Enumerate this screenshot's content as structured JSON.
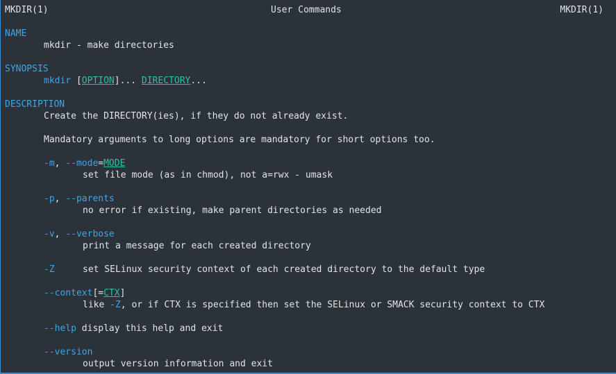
{
  "header": {
    "left": "MKDIR(1)",
    "center": "User Commands",
    "right": "MKDIR(1)"
  },
  "name": {
    "heading": "NAME",
    "text": "mkdir - make directories"
  },
  "synopsis": {
    "heading": "SYNOPSIS",
    "cmd": "mkdir",
    "lb": " [",
    "opt": "OPTION",
    "mid": "]... ",
    "dir": "DIRECTORY",
    "tail": "..."
  },
  "description": {
    "heading": "DESCRIPTION",
    "line1": "Create the DIRECTORY(ies), if they do not already exist.",
    "line2": "Mandatory arguments to long options are mandatory for short options too."
  },
  "options": {
    "mode": {
      "short": "-m",
      "sep": ", ",
      "long": "--mode",
      "eq": "=",
      "arg": "MODE",
      "desc": "set file mode (as in chmod), not a=rwx - umask"
    },
    "parents": {
      "short": "-p",
      "sep": ", ",
      "long": "--parents",
      "desc": "no error if existing, make parent directories as needed"
    },
    "verbose": {
      "short": "-v",
      "sep": ", ",
      "long": "--verbose",
      "desc": "print a message for each created directory"
    },
    "z": {
      "short": "-Z",
      "desc": "set SELinux security context of each created directory to the default type"
    },
    "context": {
      "long": "--context",
      "lb": "[=",
      "arg": "CTX",
      "rb": "]",
      "desc_pre": "like ",
      "desc_opt": "-Z",
      "desc_post": ", or if CTX is specified then set the SELinux or SMACK security context to CTX"
    },
    "help": {
      "long": "--help",
      "desc": " display this help and exit"
    },
    "version": {
      "long": "--version",
      "desc": "output version information and exit"
    }
  },
  "colors": {
    "background": "#2c3239",
    "text": "#e2e4e6",
    "heading": "#3fa6e4",
    "argument": "#2bc1a7",
    "border": "#3a8ed0"
  }
}
